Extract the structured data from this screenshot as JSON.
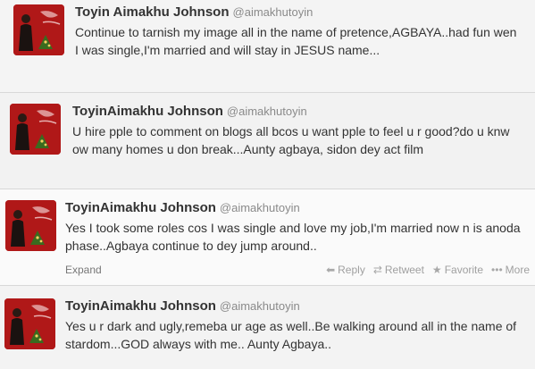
{
  "tweets": [
    {
      "name": "Toyin Aimakhu Johnson",
      "handle": "@aimakhutoyin",
      "text": "Continue to tarnish my image all in the name of pretence,AGBAYA..had fun wen I was single,I'm married and will stay in JESUS name..."
    },
    {
      "name": "ToyinAimakhu Johnson",
      "handle": "@aimakhutoyin",
      "text": "U hire pple to comment on blogs all bcos u want pple to feel u r good?do u knw ow many homes u don break...Aunty agbaya, sidon dey act film"
    },
    {
      "name": "ToyinAimakhu Johnson",
      "handle": "@aimakhutoyin",
      "text": "Yes I took some roles cos I was single and love my job,I'm married now n is anoda phase..Agbaya continue to dey jump around..",
      "actions": {
        "expand": "Expand",
        "reply": "Reply",
        "retweet": "Retweet",
        "favorite": "Favorite",
        "more": "More"
      }
    },
    {
      "name": "ToyinAimakhu Johnson",
      "handle": "@aimakhutoyin",
      "text": "Yes u r dark and ugly,remeba ur age as well..Be walking around all in the name of stardom...GOD always with me.. Aunty Agbaya.."
    }
  ],
  "icons": {
    "reply": "reply-arrow-icon",
    "retweet": "retweet-icon",
    "favorite": "star-icon",
    "more": "ellipsis-icon"
  },
  "colors": {
    "avatar_bg": "#b01818",
    "text": "#333333",
    "muted": "#999999"
  }
}
